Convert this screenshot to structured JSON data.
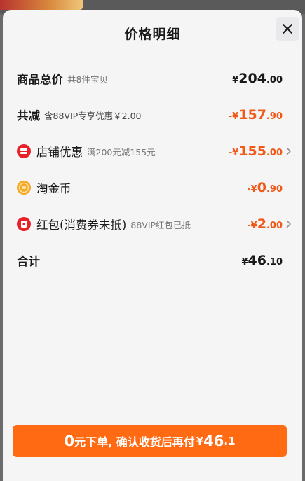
{
  "header": {
    "title": "价格明细"
  },
  "rows": [
    {
      "label": "商品总价",
      "sub": "共8件宝贝",
      "amount": {
        "currency": "¥",
        "int": "204",
        "dec": ".00"
      }
    },
    {
      "label": "共减",
      "sub": "含88VIP专享优惠￥2.00",
      "amount": {
        "currency": "-¥",
        "int": "157",
        "dec": ".90"
      }
    },
    {
      "label": "店铺优惠",
      "sub": "满200元减155元",
      "icon": "shop-coupon-icon",
      "amount": {
        "currency": "-¥",
        "int": "155",
        "dec": ".00"
      }
    },
    {
      "label": "淘金币",
      "icon": "gold-coin-icon",
      "amount": {
        "currency": "-¥",
        "int": "0",
        "dec": ".90"
      }
    },
    {
      "label": "红包(消费券未抵)",
      "sub": "88VIP红包已抵",
      "icon": "red-envelope-icon",
      "amount": {
        "currency": "-¥",
        "int": "2",
        "dec": ".00"
      }
    },
    {
      "label": "合计",
      "amount": {
        "currency": "¥",
        "int": "46",
        "dec": ".10"
      }
    }
  ],
  "cta": {
    "zero": "0",
    "text": "元下单, 确认收货后再付",
    "currency": "¥",
    "int": "46",
    "dec": ".1"
  },
  "colors": {
    "accent": "#ff6a12",
    "discount": "#f05a19",
    "text": "#1a1a1a"
  }
}
